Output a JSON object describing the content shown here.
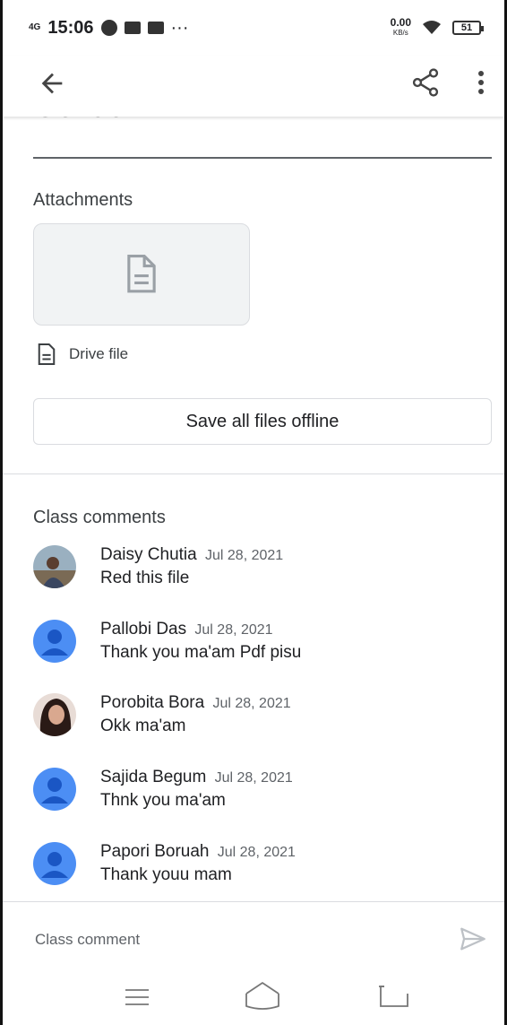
{
  "status_bar": {
    "network": "4G",
    "time": "15:06",
    "more": "···",
    "speed_value": "0.00",
    "speed_unit": "KB/s",
    "battery": "51"
  },
  "assignment": {
    "title_partial": "Gender"
  },
  "attachments": {
    "label": "Attachments",
    "file_label": "Drive file",
    "save_button": "Save all files offline"
  },
  "comments": {
    "label": "Class comments",
    "items": [
      {
        "author": "Daisy Chutia",
        "date": "Jul 28, 2021",
        "text": "Red this file",
        "avatar": "photo"
      },
      {
        "author": "Pallobi Das",
        "date": "Jul 28, 2021",
        "text": "Thank you ma'am Pdf pisu",
        "avatar": "default"
      },
      {
        "author": "Porobita Bora",
        "date": "Jul 28, 2021",
        "text": "Okk ma'am",
        "avatar": "photo"
      },
      {
        "author": "Sajida Begum",
        "date": "Jul 28, 2021",
        "text": "Thnk you ma'am",
        "avatar": "default"
      },
      {
        "author": "Papori Boruah",
        "date": "Jul 28, 2021",
        "text": "Thank youu mam",
        "avatar": "default"
      }
    ]
  },
  "comment_input": {
    "placeholder": "Class comment"
  },
  "colors": {
    "accent_avatar": "#4c8ef4",
    "divider": "#dadce0",
    "text_primary": "#202124",
    "text_secondary": "#5f6368"
  },
  "icons": {
    "back": "arrow-left-icon",
    "share": "share-icon",
    "more": "more-vert-icon",
    "file": "document-icon",
    "send": "send-icon"
  }
}
